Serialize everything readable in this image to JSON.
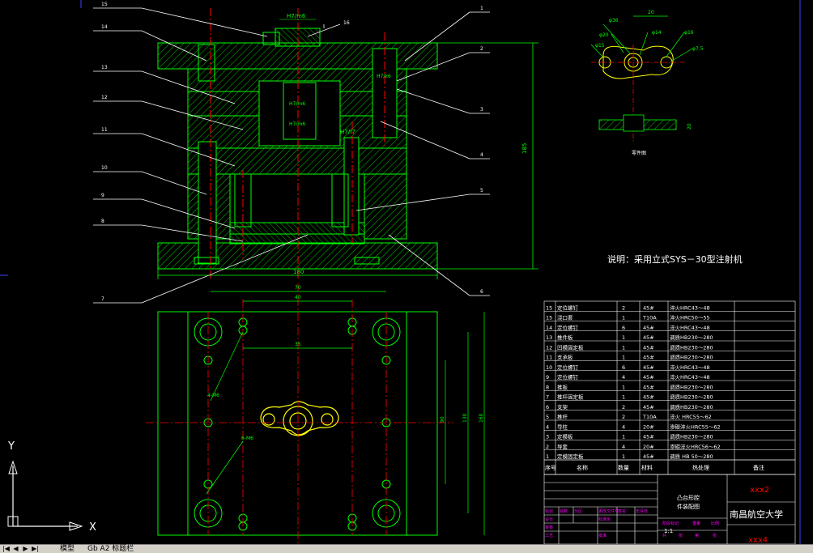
{
  "drawing": {
    "note": "说明：采用立式SYS－30型注射机",
    "part_label": "零件图",
    "university": "南昌航空大学",
    "drawing_title_1": "凸台形腔",
    "drawing_title_2": "件装配图",
    "xxx2": "xxx2",
    "xxx4": "xxx4",
    "scale": "1:1",
    "dims": {
      "top_h7m6": "H7/m6",
      "mid_h7f7": "H7/f7",
      "h7m6_a": "H7/m6",
      "h7k6": "H7/k6",
      "h7m6_b": "H7/m6",
      "overall_height": "185",
      "width_180": "180",
      "d70": "70",
      "d40": "40",
      "d35": "35",
      "d90": "90",
      "d130": "130",
      "d160": "160",
      "m6_a": "4-M6",
      "m6_b": "6-M6",
      "part_20": "20",
      "part_r16": "φ16",
      "part_r14": "φ14",
      "part_r8": "φ8",
      "part_r7": "φ7.5",
      "part_r20": "φ20",
      "part_r36": "φ36",
      "part_r15": "φ15",
      "part_h": "20"
    },
    "callouts": [
      "15",
      "14",
      "13",
      "12",
      "11",
      "10",
      "9",
      "8",
      "7",
      "16",
      "1",
      "2",
      "3",
      "4",
      "5",
      "6"
    ]
  },
  "bom": {
    "rows": [
      {
        "no": "15",
        "name": "定位螺钉",
        "qty": "2",
        "mat": "45#",
        "heat": "淬火HRC43～48"
      },
      {
        "no": "15",
        "name": "浇口套",
        "qty": "1",
        "mat": "T10A",
        "heat": "淬火HRC50～55"
      },
      {
        "no": "14",
        "name": "定位螺钉",
        "qty": "6",
        "mat": "45#",
        "heat": "淬火HRC43～48"
      },
      {
        "no": "13",
        "name": "推件板",
        "qty": "1",
        "mat": "45#",
        "heat": "调质HB230～280"
      },
      {
        "no": "12",
        "name": "凹模固定板",
        "qty": "1",
        "mat": "45#",
        "heat": "调质HB230～280"
      },
      {
        "no": "11",
        "name": "支承板",
        "qty": "1",
        "mat": "45#",
        "heat": "调质HB230～280"
      },
      {
        "no": "10",
        "name": "定位螺钉",
        "qty": "6",
        "mat": "45#",
        "heat": "淬火HRC43～48"
      },
      {
        "no": "9",
        "name": "定位螺钉",
        "qty": "4",
        "mat": "45#",
        "heat": "淬火HRC43～48"
      },
      {
        "no": "8",
        "name": "推板",
        "qty": "1",
        "mat": "45#",
        "heat": "调质HB230～280"
      },
      {
        "no": "7",
        "name": "推杆固定板",
        "qty": "1",
        "mat": "45#",
        "heat": "调质HB230～280"
      },
      {
        "no": "6",
        "name": "支架",
        "qty": "2",
        "mat": "45#",
        "heat": "调质HB230～280"
      },
      {
        "no": "5",
        "name": "推杆",
        "qty": "2",
        "mat": "T10A",
        "heat": "淬火 HRC55～62"
      },
      {
        "no": "4",
        "name": "导柱",
        "qty": "4",
        "mat": "20#",
        "heat": "渗碳淬火HRC55～62"
      },
      {
        "no": "3",
        "name": "定模板",
        "qty": "1",
        "mat": "45#",
        "heat": "调质HB230～280"
      },
      {
        "no": "2",
        "name": "导套",
        "qty": "4",
        "mat": "20#",
        "heat": "渗碳淬火HRC56～62"
      },
      {
        "no": "1",
        "name": "定模固定板",
        "qty": "1",
        "mat": "45#",
        "heat": "调质 HB 50～280"
      }
    ],
    "headers": {
      "no": "序号",
      "name": "名称",
      "qty": "数量",
      "mat": "材料",
      "heat": "热处理",
      "note": "备注"
    }
  },
  "title_block": {
    "labels": [
      "标记",
      "处数",
      "分区",
      "更改文件号",
      "签名",
      "年月日",
      "设计",
      "标准化",
      "阶段标记",
      "重量",
      "比例",
      "审核",
      "工艺",
      "批准",
      "共",
      "张",
      "第",
      "张"
    ]
  },
  "ucs": {
    "x": "X",
    "y": "Y"
  },
  "tabs": {
    "model": "模型",
    "layout1": "Gb A2 标题栏"
  },
  "colors": {
    "bg": "#000000",
    "green": "#00ff00",
    "red": "#ff0000",
    "white": "#ffffff",
    "yellow": "#ffff00",
    "magenta": "#ff00ff",
    "cyan": "#00ffff",
    "blue": "#0000ff"
  }
}
